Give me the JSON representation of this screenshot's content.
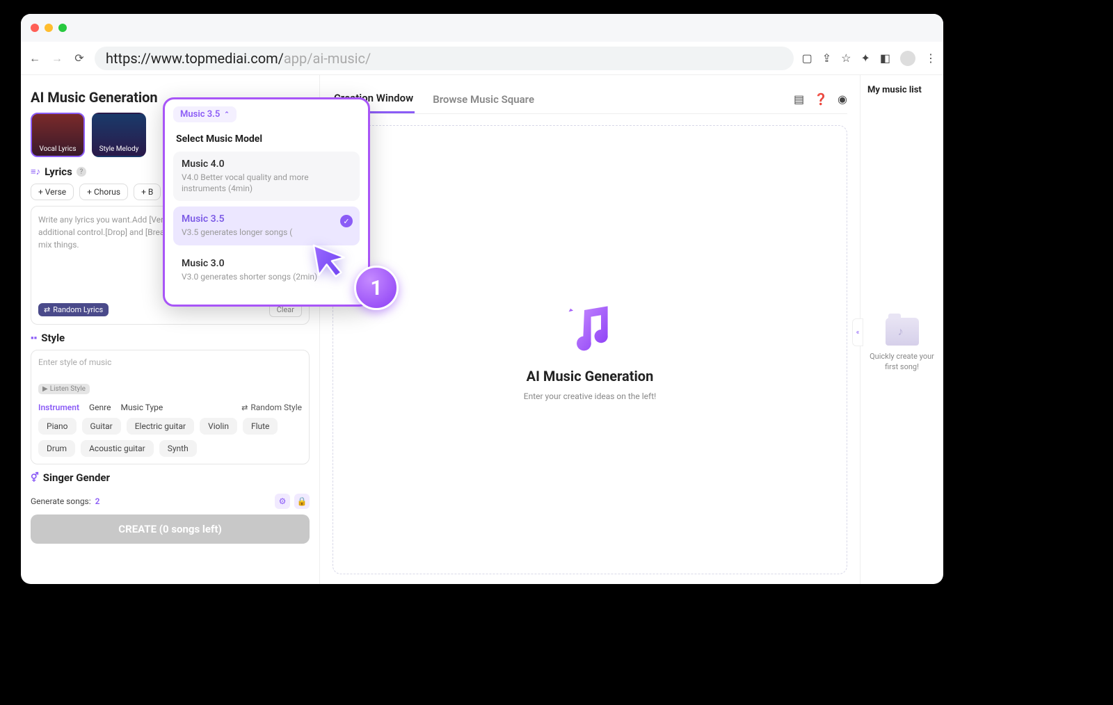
{
  "browser": {
    "url_dark": "https://www.topmediai.com/",
    "url_light": "app/ai-music/"
  },
  "page": {
    "title": "AI Music Generation"
  },
  "modes": {
    "vocal": "Vocal Lyrics",
    "style": "Style Melody"
  },
  "lyrics": {
    "heading": "Lyrics",
    "chips": {
      "verse": "+ Verse",
      "chorus": "+ Chorus",
      "bridge": "+ B"
    },
    "placeholder": "Write any lyrics you want.Add [Verse],[Chorus],[Bridge],[Intro],[Outro] for additional control.[Drop] and [Break] are EDM-specific.It's better not to mix things.",
    "random": "Random Lyrics",
    "clear": "Clear"
  },
  "style": {
    "heading": "Style",
    "placeholder": "Enter style of music",
    "listen": "Listen Style",
    "tabs": {
      "instrument": "Instrument",
      "genre": "Genre",
      "music_type": "Music Type"
    },
    "random": "Random Style",
    "tags": [
      "Piano",
      "Guitar",
      "Electric guitar",
      "Violin",
      "Flute",
      "Drum",
      "Acoustic guitar",
      "Synth"
    ]
  },
  "singer": {
    "heading": "Singer Gender"
  },
  "generate": {
    "label": "Generate songs:",
    "count": "2",
    "button": "CREATE (0 songs left)"
  },
  "center": {
    "tab_creation": "Creation Window",
    "tab_browse": "Browse Music Square",
    "heading": "AI Music Generation",
    "sub": "Enter your creative ideas on the left!"
  },
  "right": {
    "title": "My music list",
    "folder_text": "Quickly create your first song!"
  },
  "dropdown": {
    "trigger": "Music 3.5",
    "title": "Select Music Model",
    "items": [
      {
        "name": "Music 4.0",
        "desc": "V4.0 Better vocal quality and more instruments (4min)",
        "selected": false
      },
      {
        "name": "Music 3.5",
        "desc": "V3.5 generates longer songs (",
        "selected": true
      },
      {
        "name": "Music 3.0",
        "desc": "V3.0 generates shorter songs (2min)",
        "selected": false
      }
    ]
  },
  "callout": "1"
}
